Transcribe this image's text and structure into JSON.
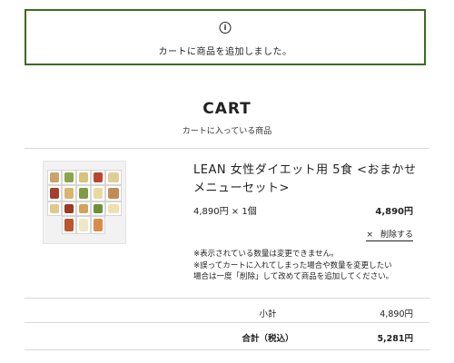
{
  "notice": {
    "message": "カートに商品を追加しました。",
    "icon": "info-icon"
  },
  "cart": {
    "title": "CART",
    "subtitle": "カートに入っている商品"
  },
  "item": {
    "name_line1": "LEAN 女性ダイエット用 5食 <おまかせ",
    "name_line2": "メニューセット>",
    "unit_line": "4,890円 × 1個",
    "line_price": "4,890円",
    "delete_label": "削除する",
    "delete_icon": "×",
    "notes": [
      "※表示されている数量は変更できません。",
      "※誤ってカートに入れてしまった場合や数量を変更したい",
      "場合は一度「削除」して改めて商品を追加してください。"
    ]
  },
  "summary": {
    "subtotal_label": "小計",
    "subtotal_value": "4,890円",
    "total_label": "合計（税込）",
    "total_value": "5,281円"
  },
  "colors": {
    "notice_border": "#3d6b1f",
    "divider": "#d9d9d9"
  }
}
